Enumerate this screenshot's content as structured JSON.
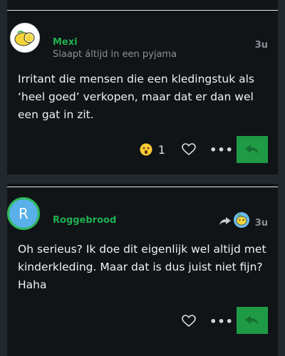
{
  "posts": [
    {
      "username": "Mexi",
      "user_title": "Slaapt áltijd in een pyjama",
      "time": "3u",
      "body": "Irritant die mensen die een kledingstuk als ‘heel goed’ verkopen, maar dat er dan wel een gat in zit.",
      "reaction_count": "1",
      "avatar_icon": "lemon-avatar"
    },
    {
      "username": "Roggebrood",
      "avatar_letter": "R",
      "time": "3u",
      "body": "Oh serieus? Ik doe dit eigenlijk wel altijd met kinderkleding. Maar dat is dus juist niet fijn? Haha",
      "avatar_color": "#5ab0e8",
      "reply_to_icon": "reply-arrow-icon"
    }
  ],
  "colors": {
    "accent": "#21b04f",
    "reply_button": "#1f9a45",
    "background": "#101417"
  }
}
